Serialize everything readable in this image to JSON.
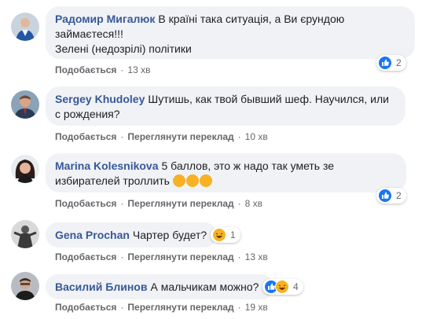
{
  "comments": [
    {
      "author": "Радомир Мигалюк",
      "text_line1": "В країні така ситуація, а Ви єрундою",
      "text_line2": "займаєтеся!!!",
      "text_line3": "Зелені (недозрілі) політики",
      "reaction_count": "2",
      "like": "Подобається",
      "time": "13 хв"
    },
    {
      "author": "Sergey Khudoley",
      "text_line1": "Шутишь, как твой бывший шеф. Научился, или",
      "text_line2": "с рождения?",
      "like": "Подобається",
      "translate": "Переглянути переклад",
      "time": "10 хв"
    },
    {
      "author": "Marina Kolesnikova",
      "text_line1": "5 баллов, это ж надо так уметь зе",
      "text_line2": "избирателей троллить",
      "reaction_count": "2",
      "like": "Подобається",
      "translate": "Переглянути переклад",
      "time": "8 хв"
    },
    {
      "author": "Gena Prochan",
      "text_line1": "Чартер будет?",
      "reaction_count": "1",
      "like": "Подобається",
      "translate": "Переглянути переклад",
      "time": "13 хв"
    },
    {
      "author": "Василий Блинов",
      "text_line1": "А мальчикам можно?",
      "reaction_count": "4",
      "like": "Подобається",
      "translate": "Переглянути переклад",
      "time": "19 хв"
    }
  ],
  "icons": {
    "like": "like-icon",
    "haha": "haha-icon"
  },
  "colors": {
    "author": "#385898",
    "bubble": "#f0f2f5",
    "like_blue": "#1877f2",
    "haha_yellow": "#f7b125",
    "meta": "#65676b"
  }
}
